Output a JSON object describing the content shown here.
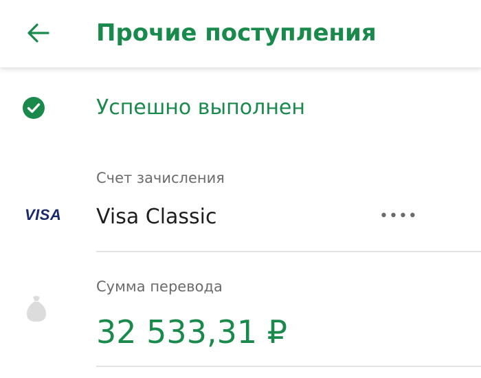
{
  "header": {
    "title": "Прочие поступления",
    "back_icon": "arrow-left-icon"
  },
  "status": {
    "icon": "check-circle-icon",
    "text": "Успешно выполнен"
  },
  "account": {
    "label": "Счет зачисления",
    "card_brand": "VISA",
    "card_name": "Visa Classic",
    "card_mask": "••••"
  },
  "amount": {
    "label": "Сумма перевода",
    "icon": "money-bag-icon",
    "value": "32 533,31 ₽"
  },
  "colors": {
    "accent": "#1a8a4c",
    "text_primary": "#1e1e1e",
    "text_secondary": "#6b6b6b",
    "divider": "#e3e3e3",
    "visa_blue": "#1a2a6c",
    "icon_grey": "#dcdcdc"
  }
}
